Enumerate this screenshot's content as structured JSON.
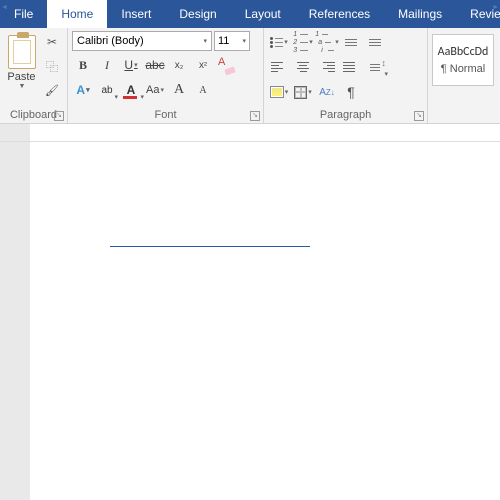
{
  "tabs": {
    "file": "File",
    "home": "Home",
    "insert": "Insert",
    "design": "Design",
    "layout": "Layout",
    "references": "References",
    "mailings": "Mailings",
    "review": "Review"
  },
  "clipboard": {
    "paste": "Paste",
    "label": "Clipboard"
  },
  "font": {
    "name": "Calibri (Body)",
    "size": "11",
    "label": "Font",
    "bold": "B",
    "italic": "I",
    "underline": "U",
    "strike": "abc",
    "sub": "x",
    "sup": "x",
    "effects": "A",
    "changecase": "Aa",
    "grow": "A",
    "shrink": "A"
  },
  "paragraph": {
    "label": "Paragraph",
    "pilcrow": "¶"
  },
  "styles": {
    "sample": "AaBbCcDd",
    "name": "¶ Normal"
  }
}
